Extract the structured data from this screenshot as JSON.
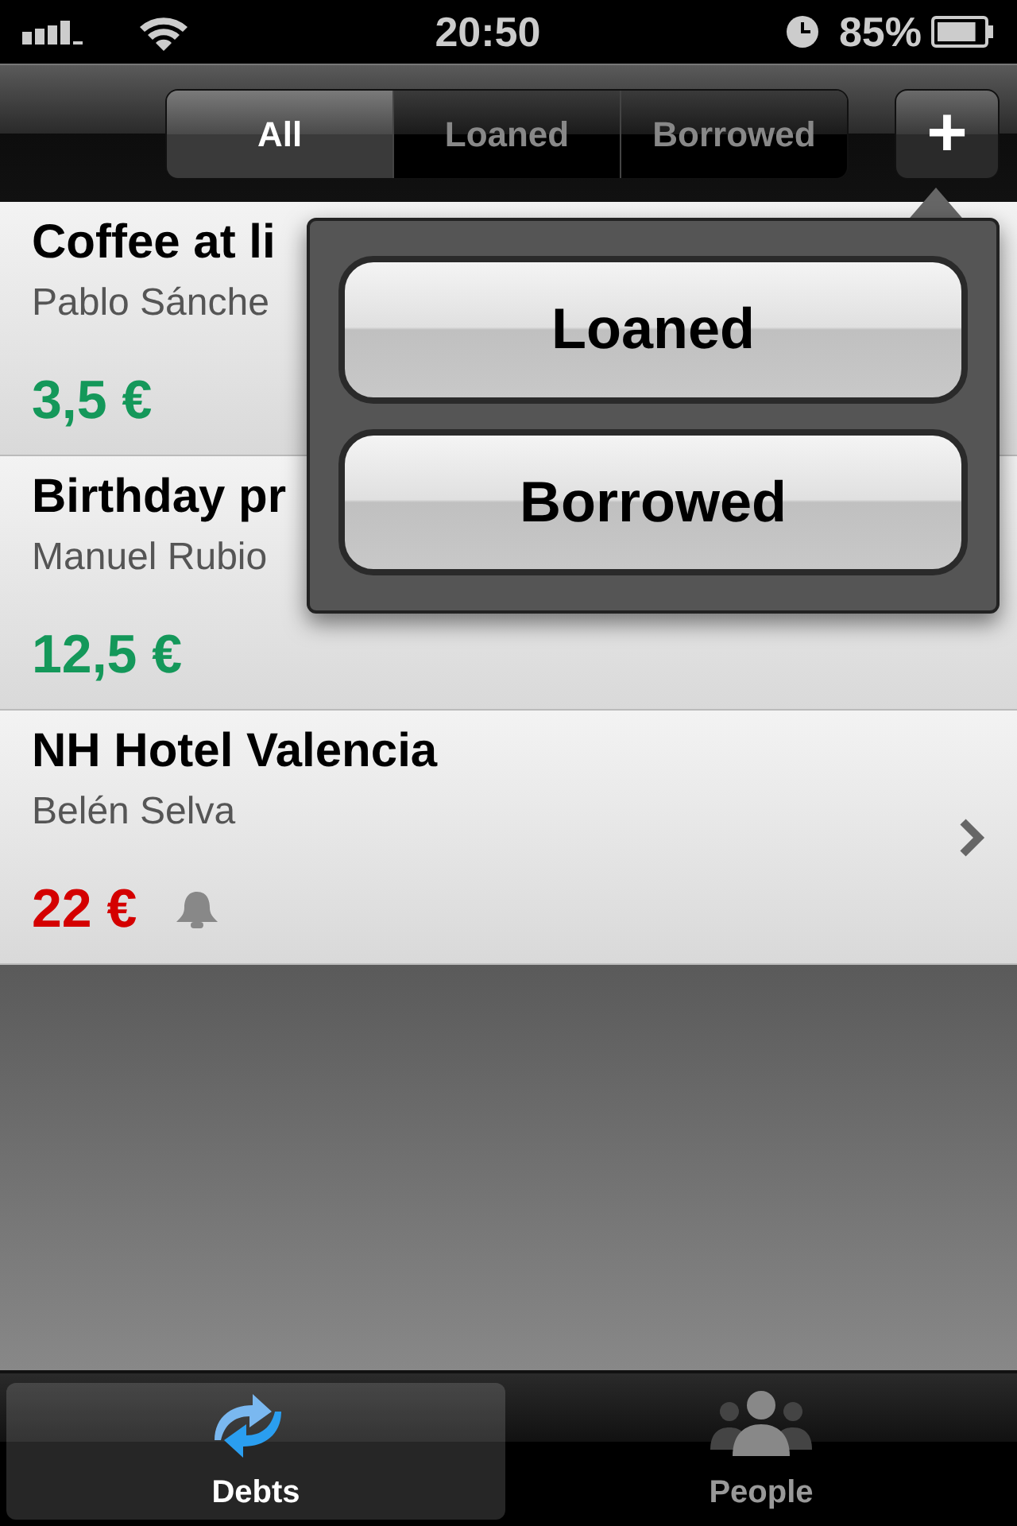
{
  "status_bar": {
    "time": "20:50",
    "battery": "85%"
  },
  "segments": [
    {
      "label": "All",
      "selected": true
    },
    {
      "label": "Loaned",
      "selected": false
    },
    {
      "label": "Borrowed",
      "selected": false
    }
  ],
  "add_button": {
    "label": "+"
  },
  "debts": [
    {
      "title": "Coffee at li",
      "person": "Pablo Sánche",
      "amount": "3,5 €",
      "kind": "loaned",
      "reminder": false,
      "chevron": false
    },
    {
      "title": "Birthday pr",
      "person": "Manuel Rubio",
      "amount": "12,5 €",
      "kind": "loaned",
      "reminder": false,
      "chevron": false
    },
    {
      "title": "NH Hotel Valencia",
      "person": "Belén Selva",
      "amount": "22 €",
      "kind": "borrowed",
      "reminder": true,
      "chevron": true
    }
  ],
  "popover": {
    "buttons": [
      "Loaned",
      "Borrowed"
    ]
  },
  "tab_bar": [
    {
      "label": "Debts",
      "selected": true
    },
    {
      "label": "People",
      "selected": false
    }
  ]
}
